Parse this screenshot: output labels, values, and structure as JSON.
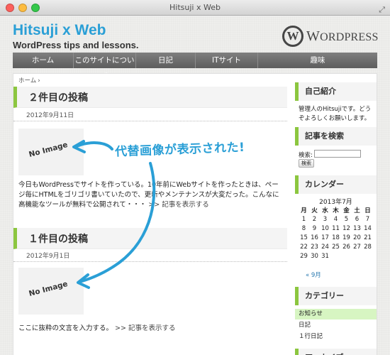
{
  "window": {
    "title": "Hitsuji x Web"
  },
  "traffic_light_colors": {
    "close": "#fc605c",
    "minimize": "#fdbc40",
    "zoom": "#34c84a"
  },
  "site": {
    "title": "Hitsuji x Web",
    "tagline": "WordPress tips and lessons.",
    "logo": {
      "mark": "W",
      "word_prefix": "W",
      "word_rest": "ORDPRESS"
    }
  },
  "nav": [
    "ホーム",
    "このサイトについて",
    "日記",
    "ITサイト",
    "趣味"
  ],
  "breadcrumb": {
    "home": "ホーム",
    "sep": "›"
  },
  "posts": [
    {
      "title": "２件目の投稿",
      "date": "2012年9月11日",
      "thumb_label": "No Image",
      "excerpt": "今日もWordPressでサイトを作っている。10年前にWebサイトを作ったときは、ページ毎にHTMLをゴリゴリ書いていたので、更新やメンテナンスが大変だった。こんなに高機能なツールが無料で公開されて・・・",
      "more": ">> 記事を表示する"
    },
    {
      "title": "１件目の投稿",
      "date": "2012年9月1日",
      "thumb_label": "No Image",
      "excerpt": "ここに抜粋の文言を入力する。",
      "more": ">> 記事を表示する"
    }
  ],
  "sidebar": {
    "profile": {
      "heading": "自己紹介",
      "text": "管理人のHitsujiです。どうぞよろしくお願いします。"
    },
    "search": {
      "heading": "記事を検索",
      "label": "検索:",
      "value": "",
      "button": "検索"
    },
    "calendar": {
      "heading": "カレンダー",
      "caption": "2013年7月",
      "weekdays": [
        "月",
        "火",
        "水",
        "木",
        "金",
        "土",
        "日"
      ],
      "weeks": [
        [
          "1",
          "2",
          "3",
          "4",
          "5",
          "6",
          "7"
        ],
        [
          "8",
          "9",
          "10",
          "11",
          "12",
          "13",
          "14"
        ],
        [
          "15",
          "16",
          "17",
          "18",
          "19",
          "20",
          "21"
        ],
        [
          "22",
          "23",
          "24",
          "25",
          "26",
          "27",
          "28"
        ],
        [
          "29",
          "30",
          "31",
          "",
          "",
          "",
          ""
        ]
      ],
      "prev": "« 9月"
    },
    "categories": {
      "heading": "カテゴリー",
      "items": [
        "お知らせ",
        "日記",
        "１行日記"
      ],
      "highlight_color": "#d7f5c2"
    },
    "next_heading": "アーカイブ"
  },
  "annotation": {
    "text": "代替画像が表示された!",
    "color": "#2a9fd6"
  },
  "colors": {
    "accent_green": "#8cc63f",
    "title_blue": "#2a9fd6",
    "nav_gray": "#6e6e6e"
  }
}
